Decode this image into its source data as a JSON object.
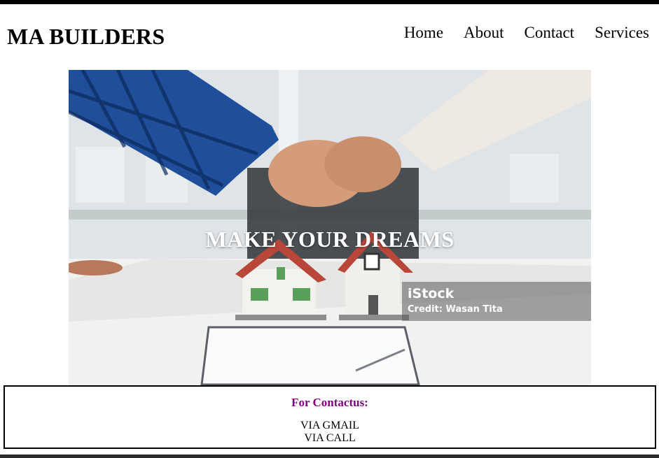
{
  "header": {
    "brand": "MA BUILDERS",
    "nav": [
      "Home",
      "About",
      "Contact",
      "Services"
    ]
  },
  "hero": {
    "title": "MAKE YOUR DREAMS",
    "watermark": {
      "logo": "iStock",
      "credit": "Credit: Wasan Tita"
    }
  },
  "contact": {
    "heading": "For Contactus:",
    "lines": [
      "VIA GMAIL",
      "VIA CALL"
    ]
  },
  "colors": {
    "contact_heading": "#800080",
    "shirt_blue": "#1f4f9a",
    "roof_red": "#b8473a"
  }
}
